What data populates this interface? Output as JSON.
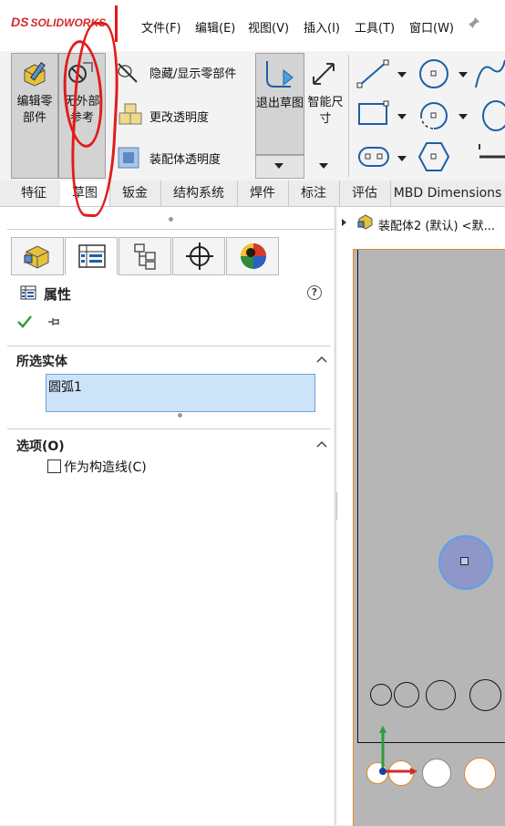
{
  "app": {
    "logo_text": "SOLIDWORKS",
    "logo_prefix": "DS",
    "brand_color": "#d42a2a"
  },
  "menu": [
    "文件(F)",
    "编辑(E)",
    "视图(V)",
    "插入(I)",
    "工具(T)",
    "窗口(W)"
  ],
  "ribbon": {
    "edit_part": "编辑零部件",
    "no_external_ref": "无外部参考",
    "hide_show": "隐藏/显示零部件",
    "change_transparency": "更改透明度",
    "assembly_transparency": "装配体透明度",
    "exit_sketch": "退出草图",
    "smart_dimension": "智能尺寸"
  },
  "tabs": [
    "特征",
    "草图",
    "钣金",
    "结构系统",
    "焊件",
    "标注",
    "评估",
    "MBD Dimensions"
  ],
  "active_tab": "草图",
  "tree_header": "装配体2 (默认) <默...",
  "property": {
    "title": "属性",
    "help_icon": "?",
    "selected_entities_title": "所选实体",
    "selected_item": "圆弧1",
    "options_title": "选项(O)",
    "construction_label": "作为构造线(C)",
    "construction_checked": false
  },
  "colors": {
    "accent_blue": "#cde4f8",
    "selection_border": "#6aa0d8",
    "graphic_bg": "#b6b6b6",
    "annotation_red": "#e21b1b"
  }
}
